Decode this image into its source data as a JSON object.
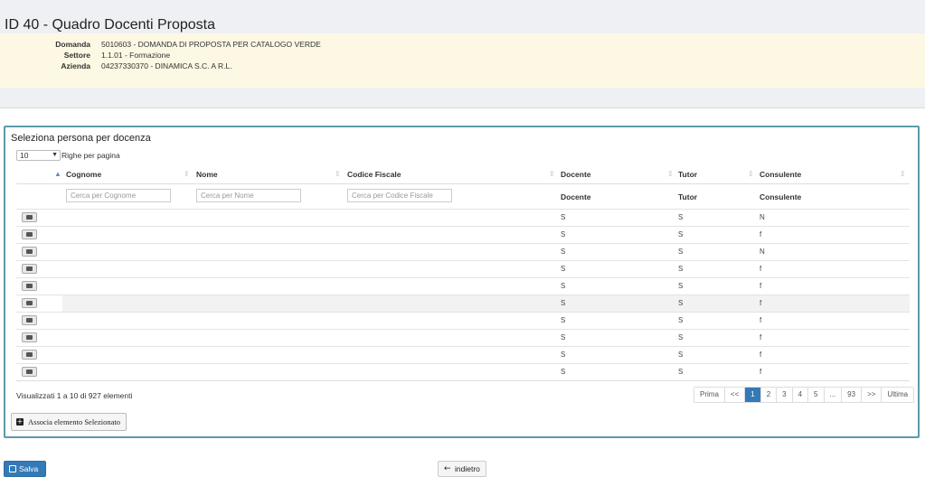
{
  "page": {
    "title": "ID 40 - Quadro Docenti Proposta"
  },
  "info": [
    {
      "label": "Domanda",
      "value": "5010603 - DOMANDA DI PROPOSTA PER CATALOGO VERDE"
    },
    {
      "label": "Settore",
      "value": "1.1.01 - Formazione"
    },
    {
      "label": "Azienda",
      "value": "04237330370 - DINAMICA S.C. A R.L."
    }
  ],
  "panel": {
    "title": "Seleziona persona per docenza",
    "rows_per_page": "10",
    "rows_per_page_label": "Righe per pagina"
  },
  "table": {
    "columns": [
      "Cognome",
      "Nome",
      "Codice Fiscale",
      "Docente",
      "Tutor",
      "Consulente"
    ],
    "filters": {
      "cognome": "Cerca per Cognome",
      "nome": "Cerca per Nome",
      "codice_fiscale": "Cerca per Codice Fiscale",
      "docente": "Docente",
      "tutor": "Tutor",
      "consulente": "Consulente"
    },
    "rows": [
      {
        "docente": "S",
        "tutor": "S",
        "consulente": "N"
      },
      {
        "docente": "S",
        "tutor": "S",
        "consulente": "f"
      },
      {
        "docente": "S",
        "tutor": "S",
        "consulente": "N"
      },
      {
        "docente": "S",
        "tutor": "S",
        "consulente": "f"
      },
      {
        "docente": "S",
        "tutor": "S",
        "consulente": "f"
      },
      {
        "docente": "S",
        "tutor": "S",
        "consulente": "f"
      },
      {
        "docente": "S",
        "tutor": "S",
        "consulente": "f"
      },
      {
        "docente": "S",
        "tutor": "S",
        "consulente": "f"
      },
      {
        "docente": "S",
        "tutor": "S",
        "consulente": "f"
      },
      {
        "docente": "S",
        "tutor": "S",
        "consulente": "f"
      }
    ]
  },
  "summary": "Visualizzati 1 a 10 di 927 elementi",
  "pagination": [
    "Prima",
    "<<",
    "1",
    "2",
    "3",
    "4",
    "5",
    "...",
    "93",
    ">>",
    "Ultima"
  ],
  "pagination_active": "1",
  "buttons": {
    "associa": "Associa elemento Selezionato",
    "salva": "Salva",
    "indietro": "indietro"
  }
}
